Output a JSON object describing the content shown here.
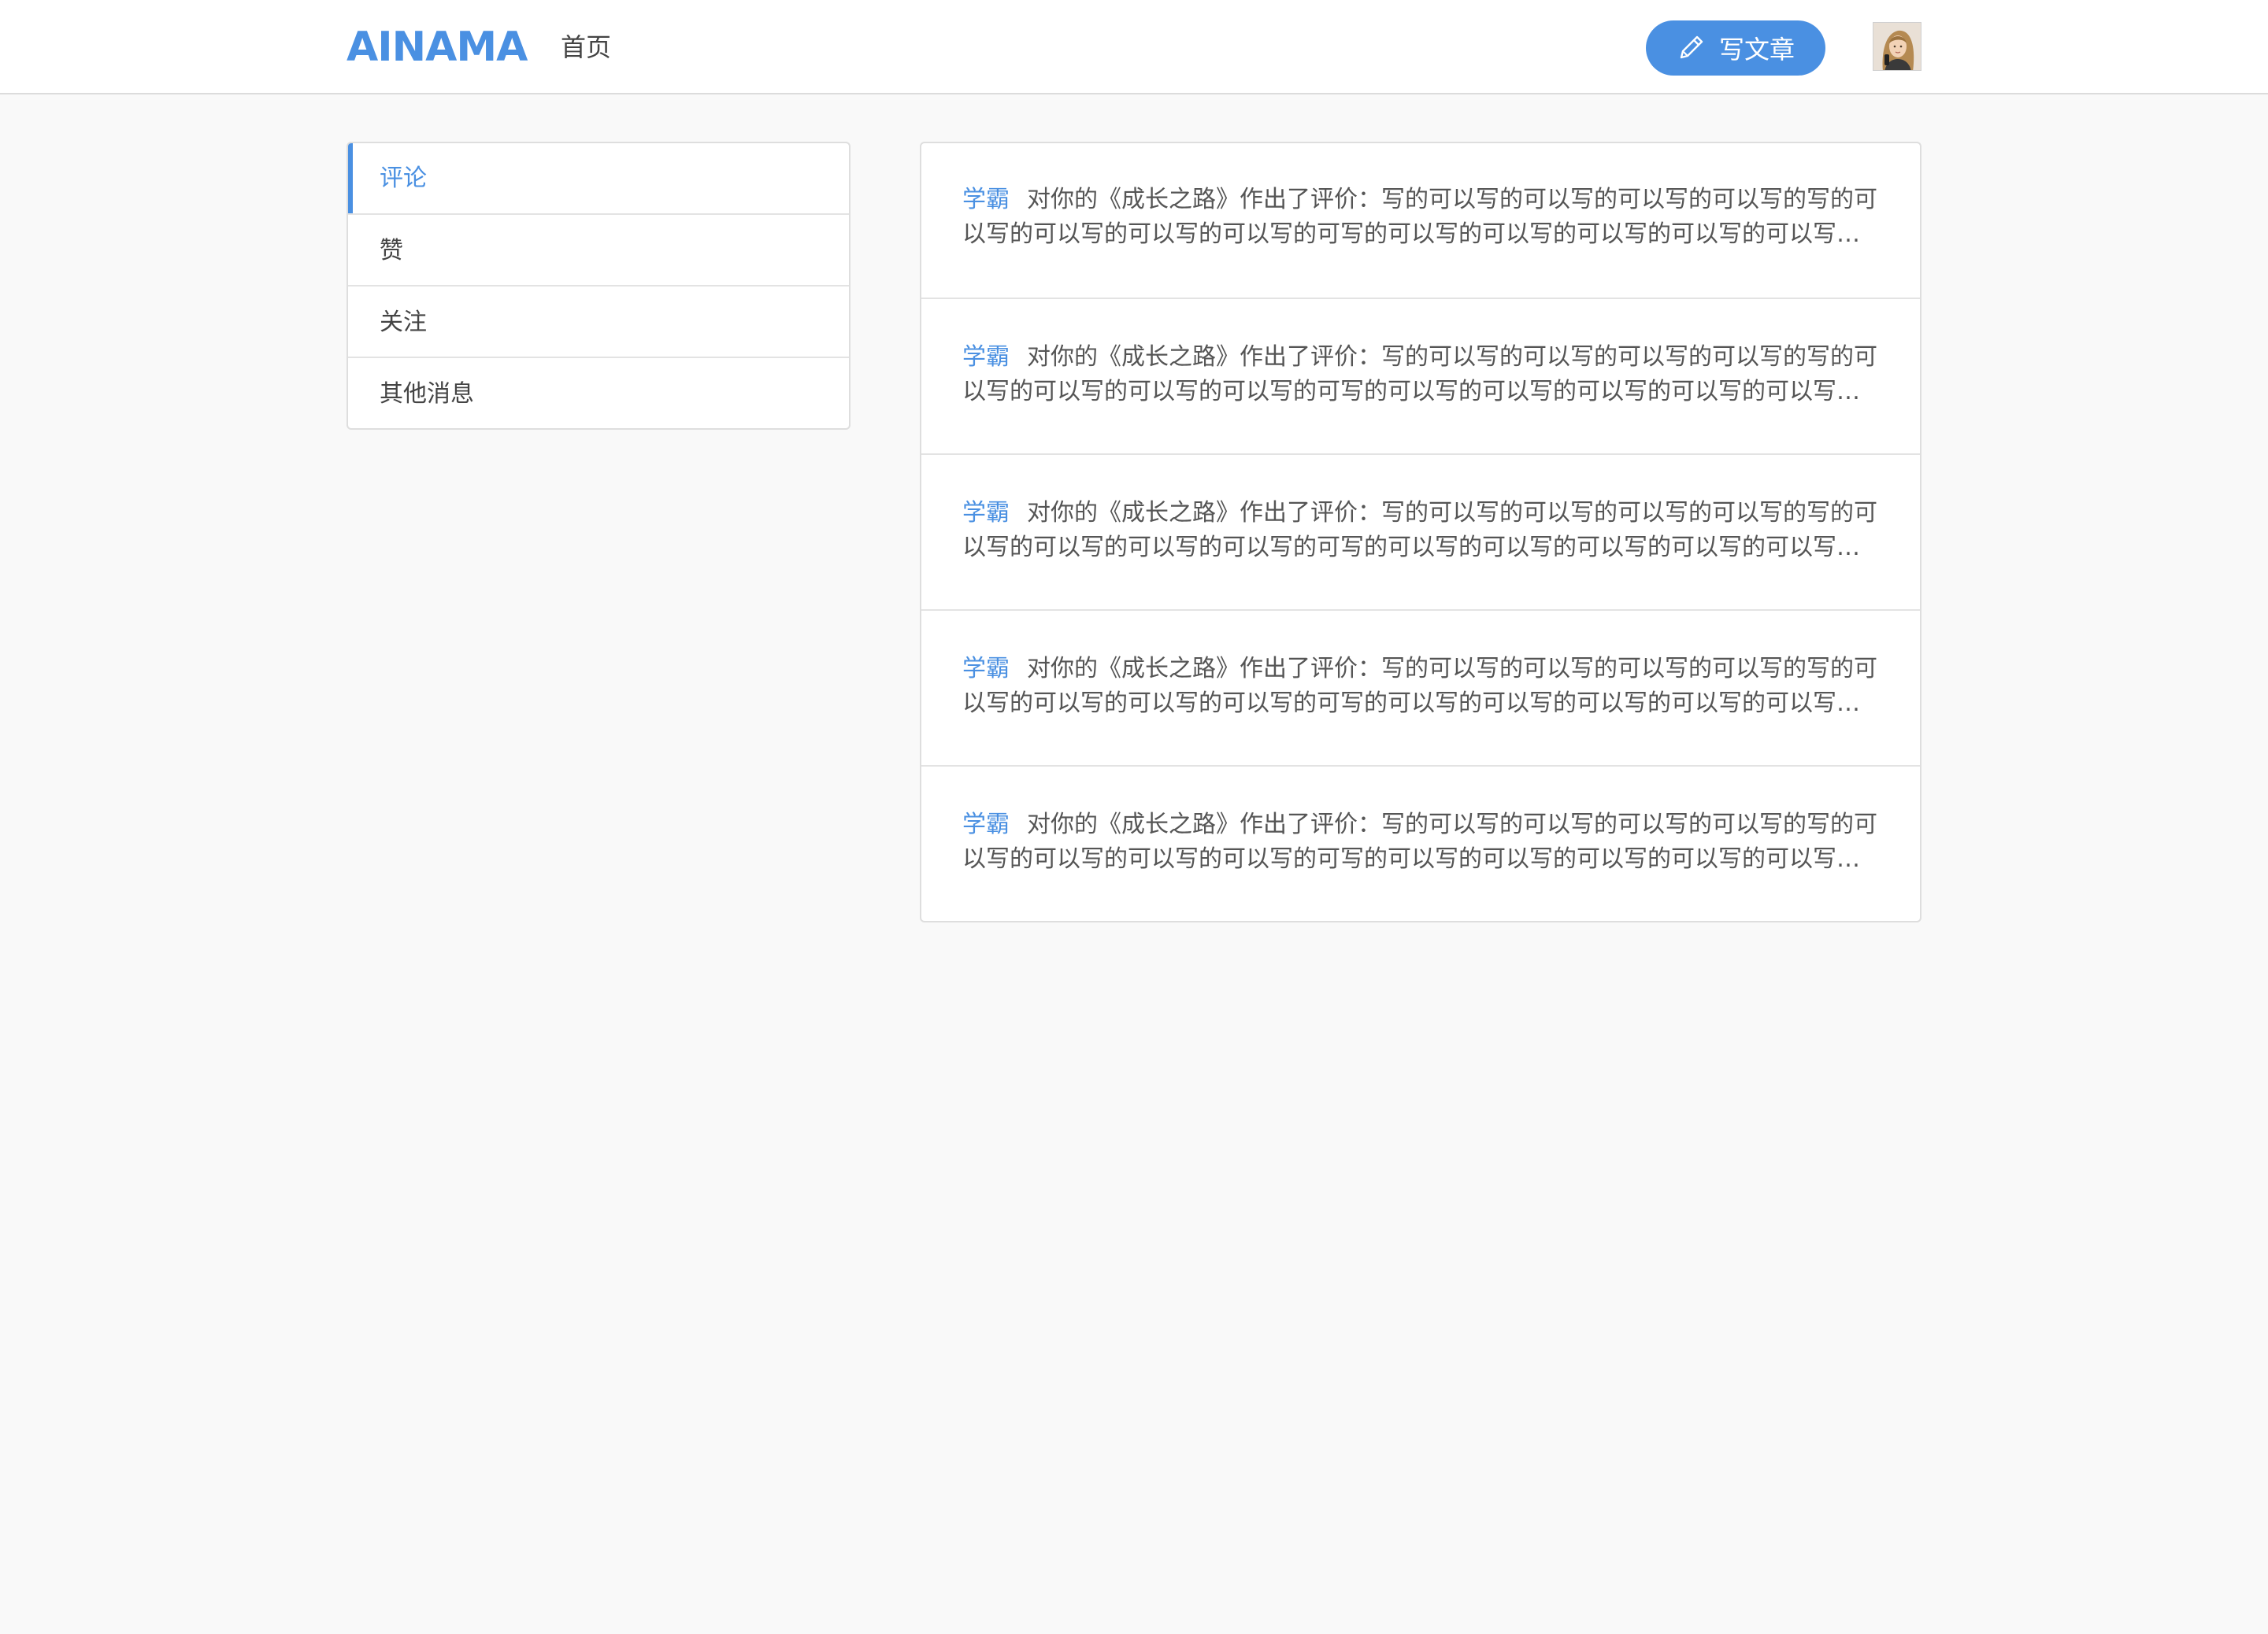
{
  "header": {
    "logo": "AINAMA",
    "nav_home": "首页",
    "write_button_label": "写文章",
    "write_button_icon": "pen-icon",
    "avatar_icon": "user-avatar"
  },
  "colors": {
    "accent": "#4a90e2",
    "background": "#f9f9f9"
  },
  "sidebar": {
    "items": [
      {
        "label": "评论",
        "active": true
      },
      {
        "label": "赞",
        "active": false
      },
      {
        "label": "关注",
        "active": false
      },
      {
        "label": "其他消息",
        "active": false
      }
    ]
  },
  "messages": [
    {
      "user": "学霸",
      "text": "对你的《成长之路》作出了评价：写的可以写的可以写的可以写的可以写的写的可以写的可以写的可以写的可以写的可写的可以写的可以写的可以写的可以写的可以写的可以写的"
    },
    {
      "user": "学霸",
      "text": "对你的《成长之路》作出了评价：写的可以写的可以写的可以写的可以写的写的可以写的可以写的可以写的可以写的可写的可以写的可以写的可以写的可以写的可以写的可以写的"
    },
    {
      "user": "学霸",
      "text": "对你的《成长之路》作出了评价：写的可以写的可以写的可以写的可以写的写的可以写的可以写的可以写的可以写的可写的可以写的可以写的可以写的可以写的可以写的可以写的"
    },
    {
      "user": "学霸",
      "text": "对你的《成长之路》作出了评价：写的可以写的可以写的可以写的可以写的写的可以写的可以写的可以写的可以写的可写的可以写的可以写的可以写的可以写的可以写的可以写的"
    },
    {
      "user": "学霸",
      "text": "对你的《成长之路》作出了评价：写的可以写的可以写的可以写的可以写的写的可以写的可以写的可以写的可以写的可写的可以写的可以写的可以写的可以写的可以写的可以写的"
    }
  ]
}
